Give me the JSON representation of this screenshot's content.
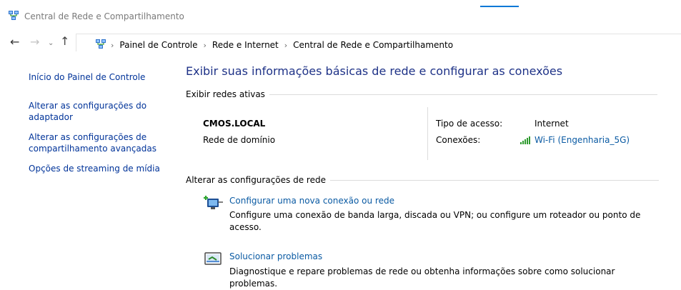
{
  "window": {
    "title": "Central de Rede e Compartilhamento"
  },
  "nav": {
    "back_glyph": "←",
    "forward_glyph": "→",
    "recent_glyph": "⌄",
    "up_glyph": "↑",
    "breadcrumbs": [
      "Painel de Controle",
      "Rede e Internet",
      "Central de Rede e Compartilhamento"
    ],
    "separator": "›"
  },
  "sidebar": {
    "home": "Início do Painel de Controle",
    "items": [
      [
        "Alterar as configurações do",
        "adaptador"
      ],
      [
        "Alterar as configurações de",
        "compartilhamento avançadas"
      ],
      [
        "Opções de streaming de mídia"
      ]
    ]
  },
  "main": {
    "title": "Exibir suas informações básicas de rede e configurar as conexões",
    "active_section": "Exibir redes ativas",
    "network": {
      "name": "CMOS.LOCAL",
      "category": "Rede de domínio",
      "access_label": "Tipo de acesso:",
      "access_value": "Internet",
      "connections_label": "Conexões:",
      "connection_link": "Wi-Fi (Engenharia_5G)"
    },
    "change_section": "Alterar as configurações de rede",
    "tasks": [
      {
        "link": "Configurar uma nova conexão ou rede",
        "desc_lines": [
          "Configure uma conexão de banda larga, discada ou VPN; ou configure um roteador ou ponto de",
          "acesso."
        ]
      },
      {
        "link": "Solucionar problemas",
        "desc_lines": [
          "Diagnostique e repare problemas de rede ou obtenha informações sobre como solucionar",
          "problemas."
        ]
      }
    ]
  },
  "icons": {
    "title": "network-center-icon",
    "address": "network-center-icon",
    "wifi": "wifi-signal-icon",
    "new_connection": "new-connection-icon",
    "troubleshoot": "troubleshoot-icon"
  },
  "colors": {
    "link": "#0a5aa3",
    "sidebar_link": "#003399",
    "title": "#1e3287",
    "accent": "#0078d7"
  }
}
